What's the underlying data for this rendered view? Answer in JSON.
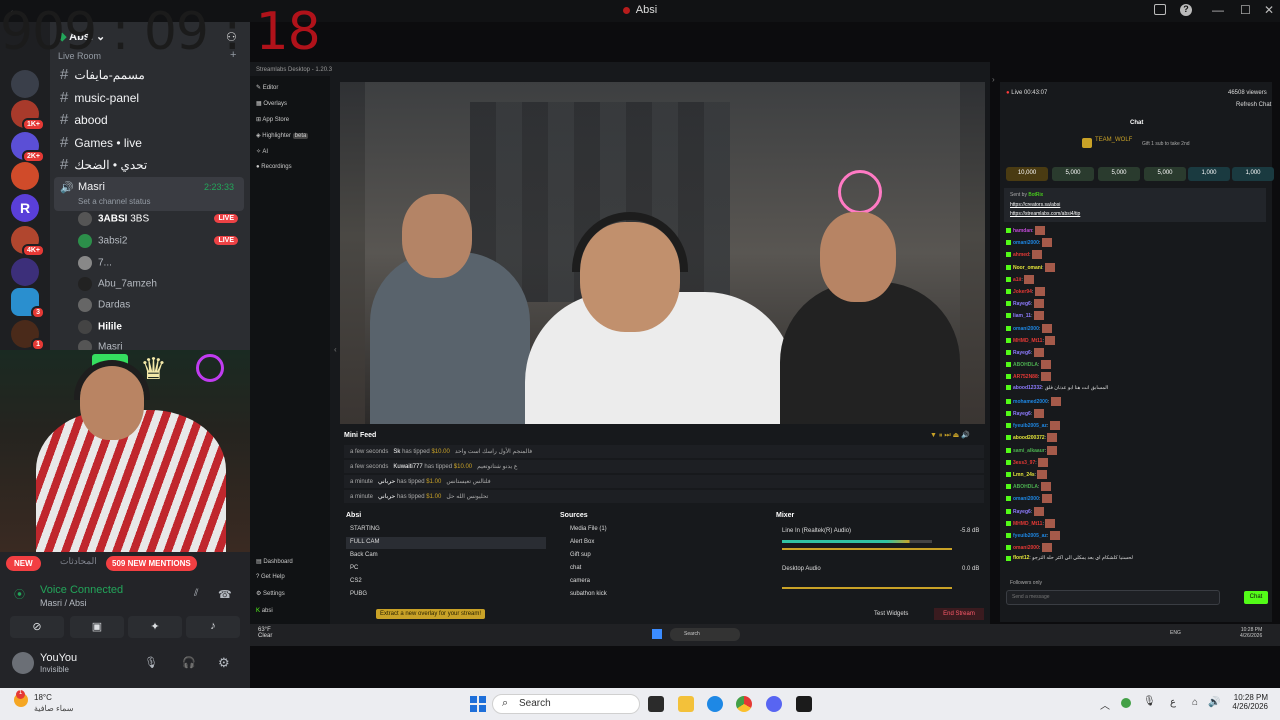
{
  "window": {
    "title": "Absi",
    "min": "—",
    "max": "☐",
    "close": "✕"
  },
  "clock": {
    "main": "909 : 09 : ",
    "seconds": "18"
  },
  "server": {
    "name": "Absi",
    "section": "Live Room"
  },
  "rail_badges": [
    "1K+",
    "2K+",
    "4K+",
    "3",
    "1"
  ],
  "channels": [
    {
      "label": "مسمم-مايفات"
    },
    {
      "label": "music-panel"
    },
    {
      "label": "abood"
    },
    {
      "label": "Games • live"
    },
    {
      "label": "تحدي • الضحك"
    }
  ],
  "voice_channel": {
    "label": "Masri",
    "time": "2:23:33",
    "status": "Set a channel status"
  },
  "members": [
    {
      "name": "3ABSI",
      "tag": "3BS",
      "live": "LIVE"
    },
    {
      "name": "3absi2",
      "live": "LIVE"
    },
    {
      "name": "7..."
    },
    {
      "name": "Abu_7amzeh"
    },
    {
      "name": "Dardas"
    },
    {
      "name": "Hilile"
    },
    {
      "name": "Masri"
    }
  ],
  "mentions": {
    "new": "NEW",
    "count": "509 NEW MENTIONS",
    "placeholder": "المحادثات"
  },
  "voice": {
    "status": "Voice Connected",
    "where": "Masri / Absi"
  },
  "user": {
    "name": "YouYou",
    "state": "Invisible"
  },
  "streamlabs": {
    "title": "Streamlabs Desktop - 1.20.3",
    "nav": [
      "Editor",
      "Overlays",
      "App Store",
      "Highlighter",
      "AI",
      "Recordings"
    ],
    "highlighter_badge": "beta",
    "nav_bottom": [
      "Dashboard",
      "Get Help",
      "Settings",
      "absi"
    ],
    "mini_feed_title": "Mini Feed",
    "feed": [
      {
        "time": "a few seconds",
        "user": "Sk",
        "action": "has tipped",
        "amount": "$10.00",
        "msg": "فالمنجم الأول راسك است واحد"
      },
      {
        "time": "a few seconds",
        "user": "Kuwaiti777",
        "action": "has tipped",
        "amount": "$10.00",
        "msg": "ع يدنو شتاتوتعيم"
      },
      {
        "time": "a minute",
        "user": "حرباني",
        "action": "has tipped",
        "amount": "$1.00",
        "msg": "فلتالس تعيستانس"
      },
      {
        "time": "a minute",
        "user": "حرباني",
        "action": "has tipped",
        "amount": "$1.00",
        "msg": "تحليونس الله حل"
      }
    ],
    "scenes_title": "Absi",
    "scenes": [
      "STARTING",
      "FULL CAM",
      "Back Cam",
      "PC",
      "CS2",
      "PUBG"
    ],
    "sources_title": "Sources",
    "sources": [
      "Media File (1)",
      "Alert Box",
      "Gift sup",
      "chat",
      "camera",
      "subathon kick"
    ],
    "mixer_title": "Mixer",
    "mixer": [
      {
        "name": "Line In (Realtek(R) Audio)",
        "db": "-5.8 dB"
      },
      {
        "name": "Desktop Audio",
        "db": "0.0 dB"
      }
    ],
    "overlay_tip": "Extract a new overlay for your stream!",
    "test_widgets": "Test Widgets",
    "end_stream": "End Stream"
  },
  "chat": {
    "live": "Live 00:43:07",
    "viewers": "46508 viewers",
    "refresh": "Refresh Chat",
    "title": "Chat",
    "pinned_user": "TEAM_WOLF",
    "pinned_text": "Gift 1 sub to take 2nd",
    "chips": [
      "10,000",
      "5,000",
      "5,000",
      "5,000",
      "1,000",
      "1,000"
    ],
    "sent_by": "Sent by",
    "bot": "BotRix",
    "pinned_link": "https://creators.sa/absi",
    "pinned_link2": "https://streamlabs.com/absi4/tip",
    "messages": [
      {
        "user": "hamdan",
        "color": "#c04ad6"
      },
      {
        "user": "omani2000",
        "color": "#1e88e5"
      },
      {
        "user": "ahmed",
        "color": "#e53935"
      },
      {
        "user": "Noor_omani",
        "color": "#e5e53a"
      },
      {
        "user": "a1ii",
        "color": "#e53935"
      },
      {
        "user": "Joker94",
        "color": "#e53935"
      },
      {
        "user": "Rayeg6",
        "color": "#8e7cff"
      },
      {
        "user": "liam_11",
        "color": "#8e7cff"
      },
      {
        "user": "omani2000",
        "color": "#1e88e5"
      },
      {
        "user": "MHMD_Mt11",
        "color": "#e53935"
      },
      {
        "user": "Rayeg6",
        "color": "#8e7cff"
      },
      {
        "user": "ABOHDLA",
        "color": "#4caf50"
      },
      {
        "user": "AR752N88",
        "color": "#e53935"
      },
      {
        "user": "abood12332",
        "color": "#8e7cff",
        "text": "المسابق انت هنا ابو عدنان فلق"
      },
      {
        "user": "mohamed2000",
        "color": "#1e88e5"
      },
      {
        "user": "Rayeg6",
        "color": "#8e7cff"
      },
      {
        "user": "fyeuib2005_az",
        "color": "#1e88e5"
      },
      {
        "user": "abood200372",
        "color": "#e5e53a"
      },
      {
        "user": "sami_alkaaur",
        "color": "#4caf50"
      },
      {
        "user": "3ess3_97",
        "color": "#e53935"
      },
      {
        "user": "Lmn_24s",
        "color": "#e5e53a"
      },
      {
        "user": "ABOHDLA",
        "color": "#4caf50"
      },
      {
        "user": "omani2000",
        "color": "#1e88e5"
      },
      {
        "user": "Rayeg6",
        "color": "#8e7cff"
      },
      {
        "user": "MHMD_Mt11",
        "color": "#e53935"
      },
      {
        "user": "fyeuib2005_az",
        "color": "#1e88e5"
      },
      {
        "user": "omani2000",
        "color": "#e53935"
      },
      {
        "user": "flont12",
        "color": "#e5e53a",
        "text": "لحسنيا كلشكام اي بعد يمكلي الي اكثر حله الترجو"
      }
    ],
    "followers_only": "Followers only",
    "input_placeholder": "Send a message",
    "send": "Chat"
  },
  "inner_taskbar": {
    "weather": "63°F",
    "cond": "Clear",
    "search": "Search",
    "time": "10:28 PM",
    "date": "4/26/2026",
    "lang": "ENG"
  },
  "taskbar": {
    "weather_temp": "18°C",
    "weather_desc": "سماء صافية",
    "search": "Search",
    "time": "10:28 PM",
    "date": "4/26/2026",
    "lang": "ع"
  }
}
